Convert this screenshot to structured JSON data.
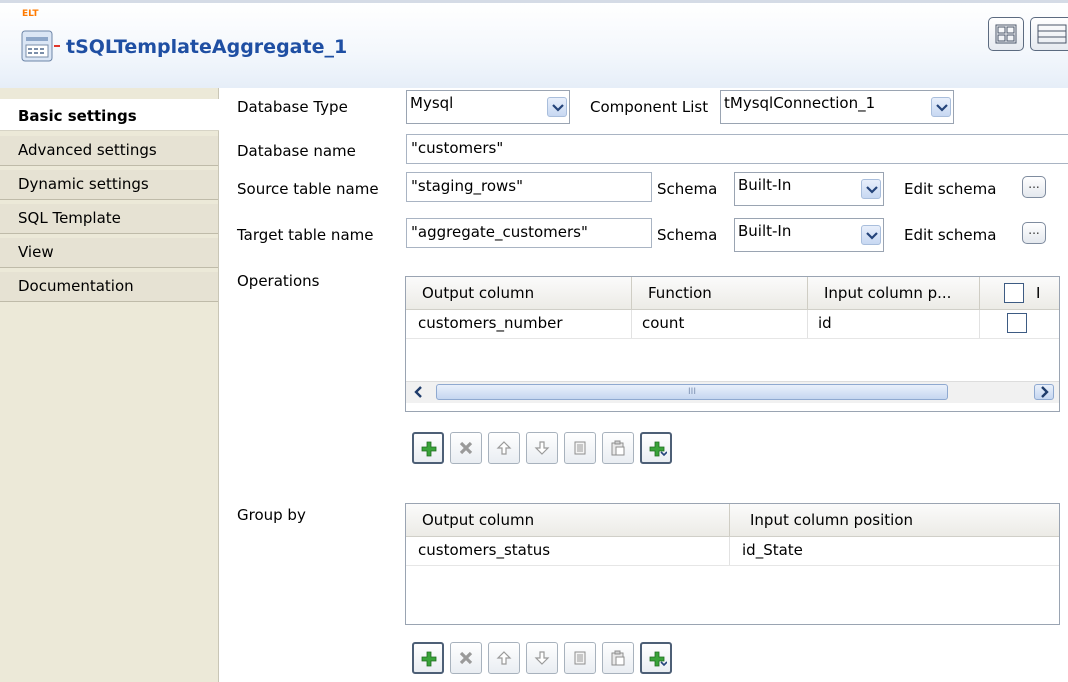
{
  "header": {
    "badge": "ELT",
    "title": "tSQLTemplateAggregate_1"
  },
  "tabs": [
    {
      "label": "Basic settings",
      "active": true
    },
    {
      "label": "Advanced settings"
    },
    {
      "label": "Dynamic settings"
    },
    {
      "label": "SQL Template"
    },
    {
      "label": "View"
    },
    {
      "label": "Documentation"
    }
  ],
  "form": {
    "database_type_label": "Database Type",
    "database_type_value": "Mysql",
    "component_list_label": "Component List",
    "component_list_value": "tMysqlConnection_1",
    "database_name_label": "Database name",
    "database_name_value": "\"customers\"",
    "source_table_label": "Source table name",
    "source_table_value": "\"staging_rows\"",
    "target_table_label": "Target table name",
    "target_table_value": "\"aggregate_customers\"",
    "schema_label": "Schema",
    "schema_value": "Built-In",
    "edit_schema_label": "Edit schema",
    "dots": "..."
  },
  "operations": {
    "label": "Operations",
    "headers": [
      "Output column",
      "Function",
      "Input column p...",
      "I"
    ],
    "rows": [
      {
        "output": "customers_number",
        "function": "count",
        "input": "id",
        "checked": false
      }
    ],
    "scroll_grip": "III"
  },
  "group_by": {
    "label": "Group by",
    "headers": [
      "Output column",
      "Input column position"
    ],
    "rows": [
      {
        "output": "customers_status",
        "input": "id_State"
      }
    ]
  },
  "toolbar_icons": [
    "add-icon",
    "delete-icon",
    "move-up-icon",
    "move-down-icon",
    "copy-icon",
    "paste-icon",
    "insert-icon"
  ],
  "colors": {
    "title": "#1f4fa3",
    "badge": "#ff7a00",
    "sidebar": "#ece9d8",
    "add_green": "#3aa33a"
  }
}
